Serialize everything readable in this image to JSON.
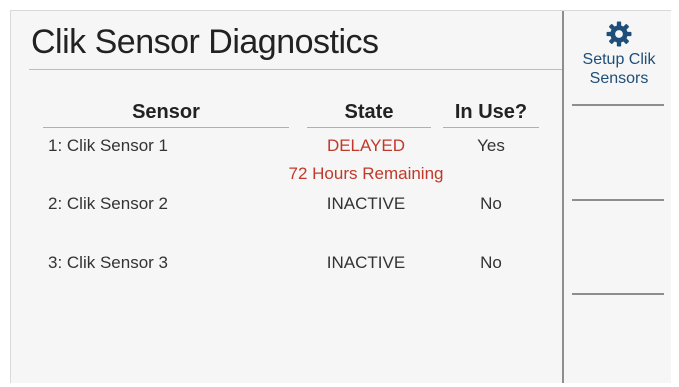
{
  "header": {
    "title": "Clik Sensor Diagnostics"
  },
  "table": {
    "columns": [
      "Sensor",
      "State",
      "In Use?"
    ],
    "rows": [
      {
        "sensor": "1: Clik Sensor 1",
        "state": "DELAYED",
        "state_detail": "72 Hours Remaining",
        "in_use": "Yes"
      },
      {
        "sensor": "2: Clik Sensor 2",
        "state": "INACTIVE",
        "in_use": "No"
      },
      {
        "sensor": "3: Clik Sensor 3",
        "state": "INACTIVE",
        "in_use": "No"
      }
    ]
  },
  "sidebar": {
    "setup_button": {
      "line1": "Setup Clik",
      "line2": "Sensors",
      "icon": "gear-icon"
    }
  },
  "colors": {
    "accent": "#1f4e79",
    "alert": "#c0392b"
  }
}
